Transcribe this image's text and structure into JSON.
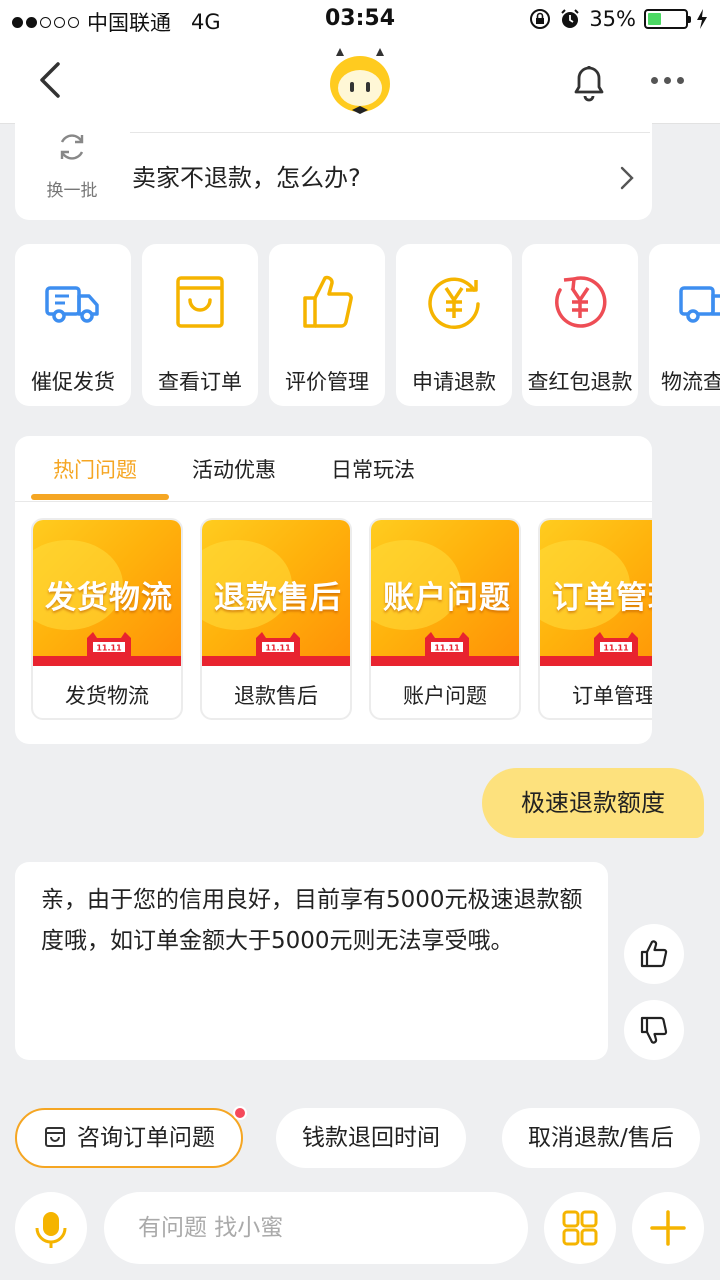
{
  "status": {
    "carrier": "中国联通",
    "network": "4G",
    "time": "03:54",
    "battery": "35%",
    "signal_bars_filled": 2,
    "signal_bars_total": 5,
    "battery_level": 0.35
  },
  "colors": {
    "accent": "#f5a623",
    "user_bubble": "#fde17d",
    "background": "#eeeff1",
    "notify_dot": "#f5495b"
  },
  "question_card": {
    "refresh_label": "换一批",
    "question": "卖家不退款，怎么办?"
  },
  "shortcuts": [
    {
      "label": "催促发货",
      "icon": "truck-icon"
    },
    {
      "label": "查看订单",
      "icon": "shopping-bag-icon"
    },
    {
      "label": "评价管理",
      "icon": "thumbs-up-icon"
    },
    {
      "label": "申请退款",
      "icon": "yuan-refund-icon"
    },
    {
      "label": "查红包退款",
      "icon": "red-envelope-refund-icon"
    },
    {
      "label": "物流查",
      "icon": "truck-icon"
    }
  ],
  "topics": {
    "tabs": [
      "热门问题",
      "活动优惠",
      "日常玩法"
    ],
    "active_tab": 0,
    "cards": [
      {
        "banner": "发货物流",
        "caption": "发货物流"
      },
      {
        "banner": "退款售后",
        "caption": "退款售后"
      },
      {
        "banner": "账户问题",
        "caption": "账户问题"
      },
      {
        "banner": "订单管理",
        "caption": "订单管理"
      }
    ]
  },
  "chat": {
    "user_message": "极速退款额度",
    "bot_reply": "亲，由于您的信用良好，目前享有5000元极速退款额度哦，如订单金额大于5000元则无法享受哦。"
  },
  "quick_chips": [
    {
      "label": "咨询订单问题",
      "highlighted": true,
      "icon": "order-box-icon",
      "has_dot": true
    },
    {
      "label": "钱款退回时间",
      "highlighted": false
    },
    {
      "label": "取消退款/售后",
      "highlighted": false
    }
  ],
  "input": {
    "placeholder": "有问题 找小蜜"
  }
}
